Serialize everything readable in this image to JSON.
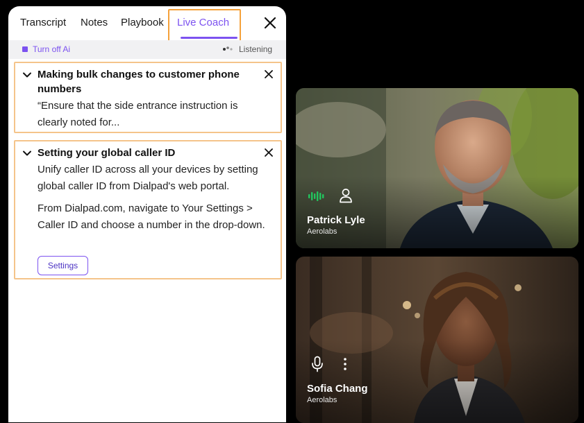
{
  "tabs": [
    {
      "label": "Transcript"
    },
    {
      "label": "Notes"
    },
    {
      "label": "Playbook"
    },
    {
      "label": "Live Coach",
      "active": true
    }
  ],
  "status": {
    "turn_off_label": "Turn off Ai",
    "listening_label": "Listening"
  },
  "cards": [
    {
      "title": "Making bulk changes to customer phone numbers",
      "body": "“Ensure that the side entrance instruction is clearly noted for..."
    },
    {
      "title": "Setting your global caller ID",
      "body_1": "Unify caller ID across all your devices by setting global caller ID from Dialpad's web portal.",
      "body_2": "From Dialpad.com, navigate to Your Settings > Caller ID and choose a number in the drop-down.",
      "button_label": "Settings"
    }
  ],
  "participants": [
    {
      "name": "Patrick Lyle",
      "company": "Aerolabs",
      "icons": [
        "audio-level-icon",
        "person-icon"
      ]
    },
    {
      "name": "Sofia Chang",
      "company": "Aerolabs",
      "icons": [
        "microphone-icon",
        "more-vertical-icon"
      ]
    }
  ],
  "colors": {
    "accent": "#7c52f0",
    "highlight_border": "#f5a13a",
    "audio_active": "#22c55e"
  }
}
